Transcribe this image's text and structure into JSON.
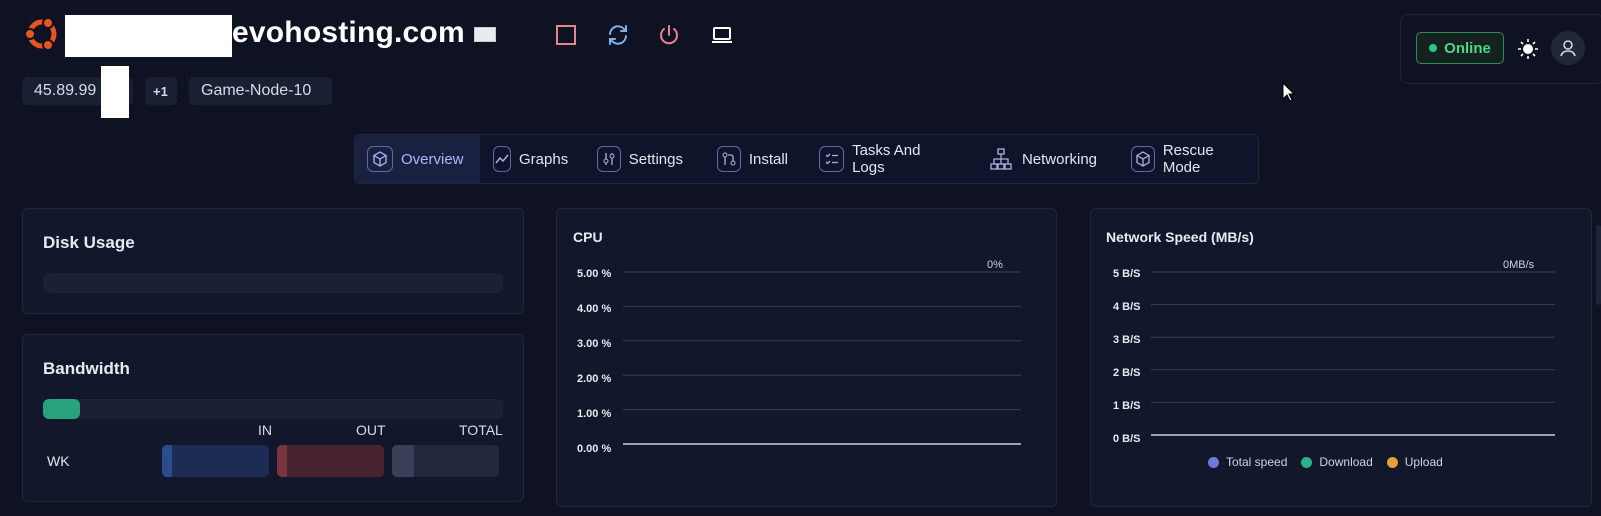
{
  "header": {
    "hostname": "evohosting.com",
    "ip": "45.89.99",
    "ip_extra": "+1",
    "node": "Game-Node-10",
    "status": "Online",
    "icons": [
      "stop-icon",
      "restart-icon",
      "power-icon",
      "console-icon"
    ]
  },
  "tabs": [
    {
      "label": "Overview",
      "icon": "cube-icon",
      "active": true
    },
    {
      "label": "Graphs",
      "icon": "graph-icon"
    },
    {
      "label": "Settings",
      "icon": "sliders-icon"
    },
    {
      "label": "Install",
      "icon": "git-icon"
    },
    {
      "label": "Tasks And Logs",
      "icon": "checklist-icon"
    },
    {
      "label": "Networking",
      "icon": "network-icon"
    },
    {
      "label": "Rescue Mode",
      "icon": "box-icon"
    }
  ],
  "disk": {
    "title": "Disk Usage",
    "usage_fraction": 0
  },
  "bandwidth": {
    "title": "Bandwidth",
    "usage_fraction": 0.08,
    "headers": {
      "in": "IN",
      "out": "OUT",
      "total": "TOTAL"
    },
    "row_label": "WK"
  },
  "cpu": {
    "title": "CPU",
    "current": "0%",
    "ticks": [
      "5.00 %",
      "4.00 %",
      "3.00 %",
      "2.00 %",
      "1.00 %",
      "0.00 %"
    ]
  },
  "network": {
    "title": "Network Speed (MB/s)",
    "current": "0MB/s",
    "ticks": [
      "5 B/S",
      "4 B/S",
      "3 B/S",
      "2 B/S",
      "1 B/S",
      "0 B/S"
    ],
    "legend": [
      {
        "name": "Total speed",
        "color": "#6f79d8"
      },
      {
        "name": "Download",
        "color": "#2bb08a"
      },
      {
        "name": "Upload",
        "color": "#e0a03a"
      }
    ]
  },
  "chart_data": [
    {
      "type": "line",
      "title": "CPU",
      "ylim": [
        0,
        5
      ],
      "series": [
        {
          "values": [
            0,
            0
          ]
        }
      ]
    },
    {
      "type": "line",
      "title": "Network Speed (MB/s)",
      "ylim": [
        0,
        5
      ],
      "series": [
        {
          "name": "Total speed",
          "values": [
            0,
            0
          ]
        },
        {
          "name": "Download",
          "values": [
            0,
            0
          ]
        },
        {
          "name": "Upload",
          "values": [
            0,
            0
          ]
        }
      ]
    }
  ],
  "colors": {
    "background": "#0f1223",
    "accent": "#a9b8ff",
    "online": "#4fd48c",
    "in": "#1c2c55",
    "out": "#4a2330",
    "total": "#23283e"
  }
}
